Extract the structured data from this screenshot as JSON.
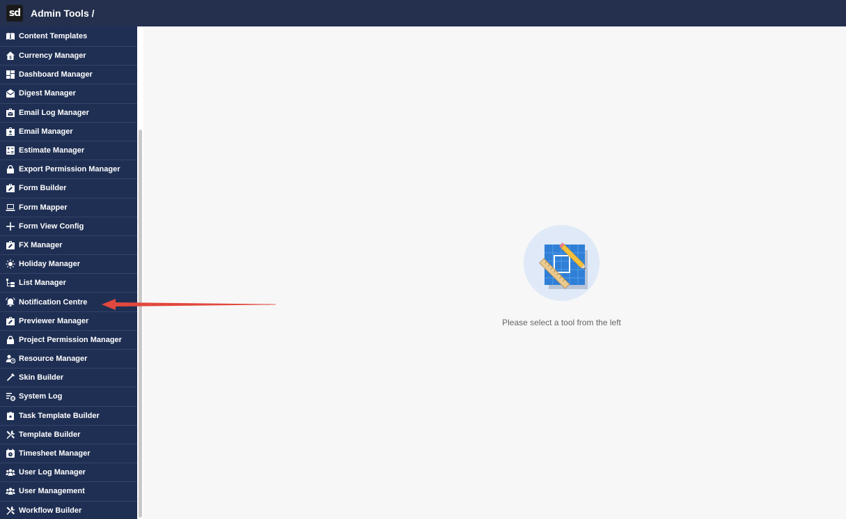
{
  "header": {
    "logo_text": "sd",
    "title": "Admin Tools /"
  },
  "sidebar": {
    "items": [
      {
        "label": "Content Templates",
        "icon": "book-open-icon"
      },
      {
        "label": "Currency Manager",
        "icon": "house-dollar-icon"
      },
      {
        "label": "Dashboard Manager",
        "icon": "dashboard-grid-icon"
      },
      {
        "label": "Digest Manager",
        "icon": "envelope-open-icon"
      },
      {
        "label": "Email Log Manager",
        "icon": "briefcase-envelope-icon"
      },
      {
        "label": "Email Manager",
        "icon": "briefcase-user-icon"
      },
      {
        "label": "Estimate Manager",
        "icon": "calculator-icon"
      },
      {
        "label": "Export Permission Manager",
        "icon": "lock-icon"
      },
      {
        "label": "Form Builder",
        "icon": "briefcase-pencil-icon"
      },
      {
        "label": "Form Mapper",
        "icon": "laptop-icon"
      },
      {
        "label": "Form View Config",
        "icon": "plus-icon"
      },
      {
        "label": "FX Manager",
        "icon": "briefcase-pencil-icon"
      },
      {
        "label": "Holiday Manager",
        "icon": "sun-icon"
      },
      {
        "label": "List Manager",
        "icon": "tree-list-icon"
      },
      {
        "label": "Notification Centre",
        "icon": "bell-ringing-icon"
      },
      {
        "label": "Previewer Manager",
        "icon": "briefcase-pencil-icon"
      },
      {
        "label": "Project Permission Manager",
        "icon": "lock-icon"
      },
      {
        "label": "Resource Manager",
        "icon": "user-clock-icon"
      },
      {
        "label": "Skin Builder",
        "icon": "eyedropper-icon"
      },
      {
        "label": "System Log",
        "icon": "list-gear-icon"
      },
      {
        "label": "Task Template Builder",
        "icon": "clipboard-icon"
      },
      {
        "label": "Template Builder",
        "icon": "tools-icon"
      },
      {
        "label": "Timesheet Manager",
        "icon": "calendar-clock-icon"
      },
      {
        "label": "User Log Manager",
        "icon": "users-icon"
      },
      {
        "label": "User Management",
        "icon": "users-icon"
      },
      {
        "label": "Workflow Builder",
        "icon": "tools-icon"
      }
    ]
  },
  "main": {
    "empty_state_icon": "blueprint-ruler-pencil-icon",
    "empty_state_text": "Please select a tool from the left"
  },
  "annotation": {
    "arrow_color": "#e2483d",
    "points_to": "Notification Centre"
  },
  "colors": {
    "topbar": "#24304d",
    "sidebar": "#1f2f53",
    "main_bg": "#f7f7f7"
  }
}
